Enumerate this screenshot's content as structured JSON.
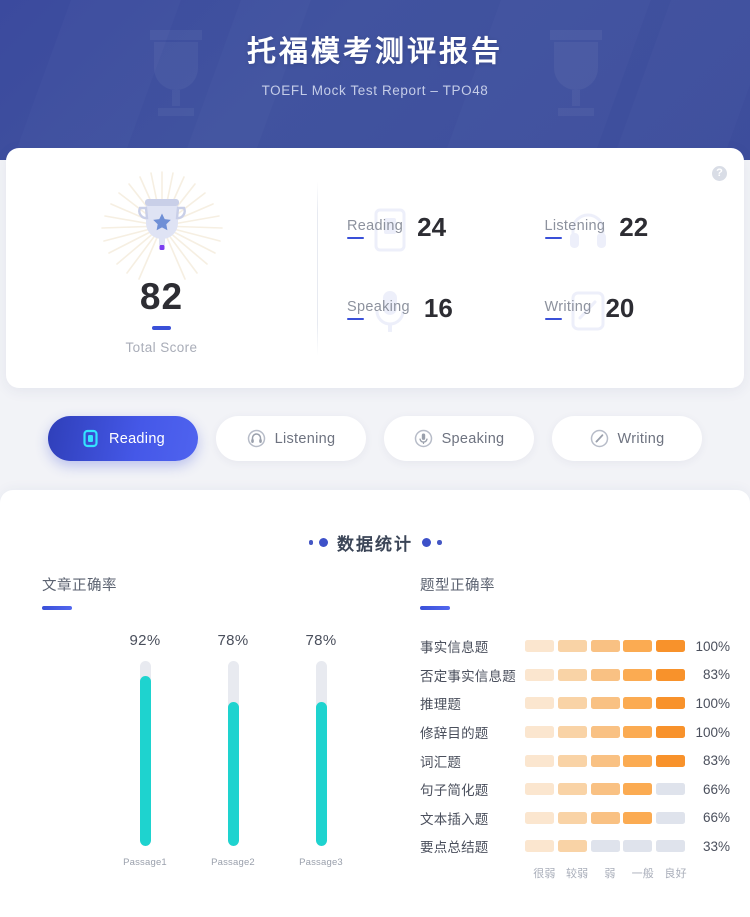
{
  "header": {
    "title": "托福模考测评报告",
    "subtitle": "TOEFL Mock Test Report – TPO48"
  },
  "score_card": {
    "help_icon": "question-mark-icon",
    "total_value": "82",
    "total_label": "Total Score",
    "trophy_icon": "trophy-icon",
    "sections": [
      {
        "name": "Reading",
        "score": "24",
        "icon": "book-icon"
      },
      {
        "name": "Listening",
        "score": "22",
        "icon": "headphone-icon"
      },
      {
        "name": "Speaking",
        "score": "16",
        "icon": "microphone-icon"
      },
      {
        "name": "Writing",
        "score": "20",
        "icon": "pencil-icon"
      }
    ]
  },
  "tabs": [
    {
      "label": "Reading",
      "icon": "book-icon",
      "active": true
    },
    {
      "label": "Listening",
      "icon": "headphone-icon",
      "active": false
    },
    {
      "label": "Speaking",
      "icon": "microphone-icon",
      "active": false
    },
    {
      "label": "Writing",
      "icon": "pencil-icon",
      "active": false
    }
  ],
  "stats": {
    "title": "数据统计",
    "passage_panel_title": "文章正确率",
    "question_panel_title": "题型正确率"
  },
  "colors": {
    "header_bg": "#3d4d9c",
    "page_bg": "#f2f3f7",
    "accent_blue": "#3a50d8",
    "bar_cyan": "#1ed3cf",
    "segment_inactive": "#dfe3ec",
    "segment_scale": [
      "#fbe6cf",
      "#f9d3a6",
      "#f9c183",
      "#fbab52",
      "#f8922b"
    ]
  },
  "chart_data": [
    {
      "type": "bar",
      "title": "文章正确率",
      "categories": [
        "Passage1",
        "Passage2",
        "Passage3"
      ],
      "values": [
        92,
        78,
        78
      ],
      "value_labels": [
        "92%",
        "78%",
        "78%"
      ],
      "ylabel": "",
      "xlabel": "",
      "ylim": [
        0,
        100
      ],
      "grid": false,
      "orientation": "vertical",
      "series_color": "#1ed3cf"
    },
    {
      "type": "bar",
      "title": "题型正确率",
      "orientation": "horizontal-segmented",
      "segments_per_row": 5,
      "legend_position": "bottom",
      "legend": [
        "很弱",
        "较弱",
        "弱",
        "一般",
        "良好"
      ],
      "categories": [
        "事实信息题",
        "否定事实信息题",
        "推理题",
        "修辞目的题",
        "词汇题",
        "句子简化题",
        "文本插入题",
        "要点总结题"
      ],
      "values": [
        100,
        83,
        100,
        100,
        83,
        66,
        66,
        33
      ],
      "value_labels": [
        "100%",
        "83%",
        "100%",
        "100%",
        "83%",
        "66%",
        "66%",
        "33%"
      ],
      "filled_segments": [
        5,
        5,
        5,
        5,
        5,
        4,
        4,
        2
      ]
    }
  ]
}
